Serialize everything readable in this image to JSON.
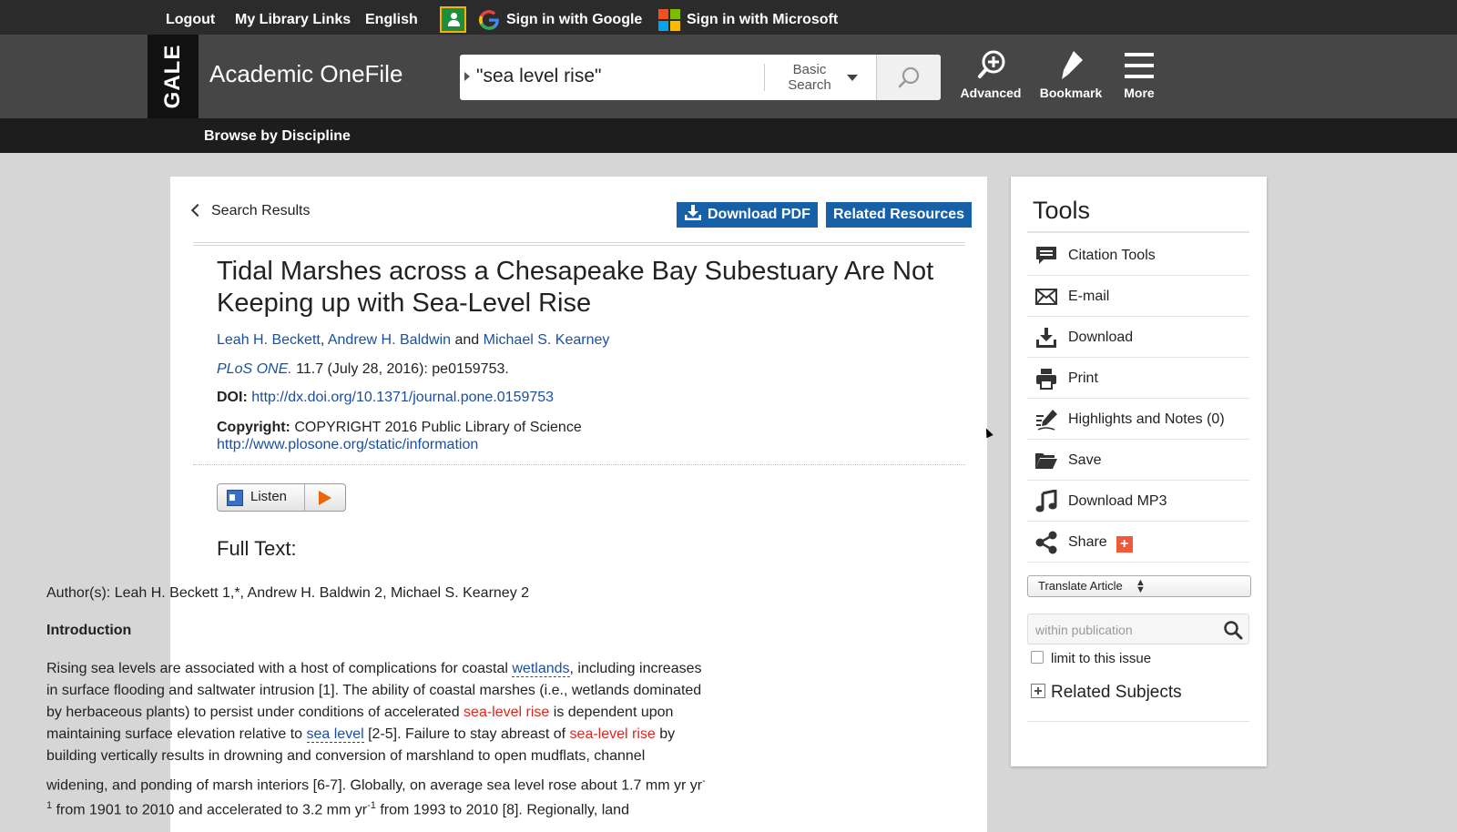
{
  "topbar": {
    "logout": "Logout",
    "library_links": "My Library Links",
    "language": "English",
    "google_signin": "Sign in with Google",
    "microsoft_signin": "Sign in with Microsoft"
  },
  "header": {
    "logo": "GALE",
    "app_title": "Academic OneFile",
    "search": {
      "query": "\"sea level rise\"",
      "type_line1": "Basic",
      "type_line2": "Search"
    },
    "tools": [
      "Advanced",
      "Bookmark",
      "More"
    ]
  },
  "nav": {
    "browse": "Browse by Discipline"
  },
  "article": {
    "back_link": "Search Results",
    "download_pdf": "Download PDF",
    "related_resources": "Related Resources",
    "title": "Tidal Marshes across a Chesapeake Bay Subestuary Are Not Keeping up with Sea-Level Rise",
    "authors": [
      "Leah H. Beckett",
      "Andrew H. Baldwin",
      "Michael S. Kearney"
    ],
    "authors_sep": ",",
    "authors_and": "and",
    "journal": "PLoS ONE.",
    "citation": "11.7 (July 28, 2016): pe0159753.",
    "doi_label": "DOI:",
    "doi_link": "http://dx.doi.org/10.1371/journal.pone.0159753",
    "copyright_label": "Copyright:",
    "copyright_text": "COPYRIGHT 2016 Public Library of Science",
    "copyright_link": "http://www.plosone.org/static/information",
    "listen": "Listen",
    "full_text_heading": "Full Text:",
    "full_text_authors": "Author(s): Leah H. Beckett 1,*, Andrew H. Baldwin 2, Michael S. Kearney 2",
    "intro_heading": "Introduction",
    "body": {
      "l1a": "Rising sea levels are associated with a host of complications for coastal ",
      "l1link": "wetlands",
      "l1b": ", including increases",
      "l2": "in surface flooding and saltwater intrusion [1]. The ability of coastal marshes (i.e., wetlands dominated",
      "l3a": "by herbaceous plants) to persist under conditions of accelerated ",
      "l3hl": "sea-level rise",
      "l3b": " is dependent upon",
      "l4a": "maintaining surface elevation relative to ",
      "l4link": "sea level",
      "l4b": " [2-5]. Failure to stay abreast of ",
      "l4hl": "sea-level rise",
      "l4c": " by",
      "l5": "building vertically results in drowning and conversion of marshland to open mudflats, channel",
      "l6a": "widening, and ponding of marsh interiors [6-7]. Globally, on average sea level rose about 1.7 mm yr yr",
      "l6sup": "-",
      "l7sup1": "1",
      "l7a": " from 1901 to 2010 and accelerated to 3.2 mm yr",
      "l7sup2": "-1",
      "l7b": " from 1993 to 2010 [8]. Regionally, land"
    }
  },
  "tools_panel": {
    "title": "Tools",
    "items": [
      "Citation Tools",
      "E-mail",
      "Download",
      "Print",
      "Highlights and Notes (0)",
      "Save",
      "Download MP3",
      "Share"
    ],
    "share_plus": "+",
    "translate": "Translate Article",
    "publication_search_placeholder": "within publication",
    "limit_label": "limit to this issue",
    "related_subjects": "Related Subjects"
  }
}
